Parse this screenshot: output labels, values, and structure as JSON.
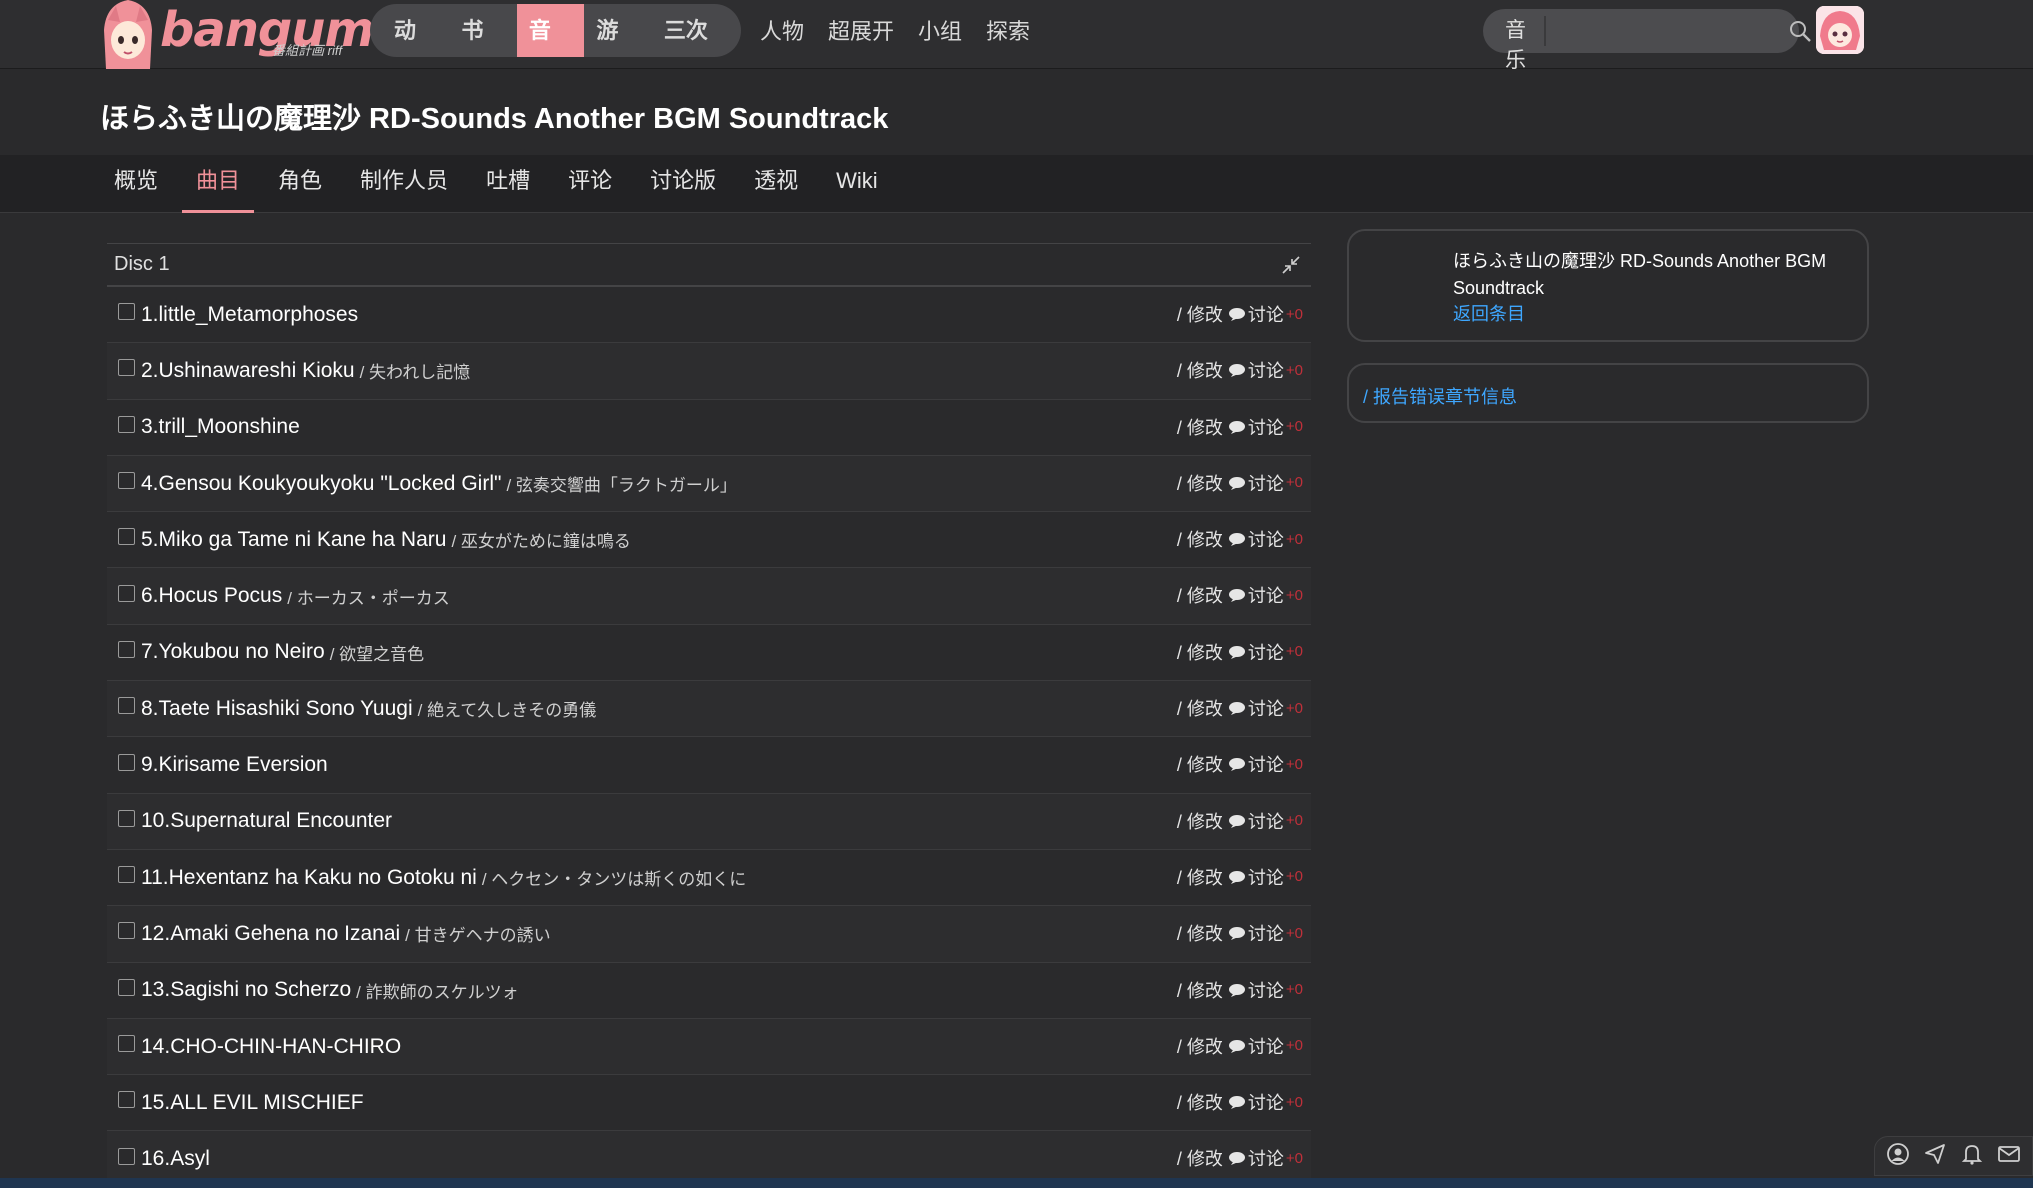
{
  "header": {
    "logo_text": "bangumi",
    "logo_sub": "番組計画 riff",
    "category_tabs": [
      {
        "label": "动画",
        "active": false
      },
      {
        "label": "书籍",
        "active": false
      },
      {
        "label": "音乐",
        "active": true
      },
      {
        "label": "游戏",
        "active": false
      },
      {
        "label": "三次元",
        "active": false
      }
    ],
    "nav_links": [
      "人物",
      "超展开",
      "小组",
      "探索"
    ],
    "search": {
      "category": "音乐",
      "value": ""
    }
  },
  "page": {
    "title": "ほらふき山の魔理沙 RD-Sounds Another BGM Soundtrack",
    "tabs": [
      {
        "label": "概览",
        "active": false
      },
      {
        "label": "曲目",
        "active": true
      },
      {
        "label": "角色",
        "active": false
      },
      {
        "label": "制作人员",
        "active": false
      },
      {
        "label": "吐槽",
        "active": false
      },
      {
        "label": "评论",
        "active": false
      },
      {
        "label": "讨论版",
        "active": false
      },
      {
        "label": "透视",
        "active": false
      },
      {
        "label": "Wiki",
        "active": false
      }
    ]
  },
  "tracklist": {
    "disc_title": "Disc 1",
    "edit_label": "/ 修改",
    "discuss_label": "讨论",
    "plus_label": "+0",
    "tracks": [
      {
        "name": "1.little_Metamorphoses",
        "sub": ""
      },
      {
        "name": "2.Ushinawareshi Kioku",
        "sub": "/ 失われし記憶"
      },
      {
        "name": "3.trill_Moonshine",
        "sub": ""
      },
      {
        "name": "4.Gensou Koukyoukyoku \"Locked Girl\"",
        "sub": "/ 弦奏交響曲「ラクトガール」"
      },
      {
        "name": "5.Miko ga Tame ni Kane ha Naru",
        "sub": "/ 巫女がために鐘は鳴る"
      },
      {
        "name": "6.Hocus Pocus",
        "sub": "/ ホーカス・ポーカス"
      },
      {
        "name": "7.Yokubou no Neiro",
        "sub": "/ 欲望之音色"
      },
      {
        "name": "8.Taete Hisashiki Sono Yuugi",
        "sub": "/ 絶えて久しきその勇儀"
      },
      {
        "name": "9.Kirisame Eversion",
        "sub": ""
      },
      {
        "name": "10.Supernatural Encounter",
        "sub": ""
      },
      {
        "name": "11.Hexentanz ha Kaku no Gotoku ni",
        "sub": "/ ヘクセン・タンツは斯くの如くに"
      },
      {
        "name": "12.Amaki Gehena no Izanai",
        "sub": "/ 甘きゲヘナの誘い"
      },
      {
        "name": "13.Sagishi no Scherzo",
        "sub": "/ 詐欺師のスケルツォ"
      },
      {
        "name": "14.CHO-CHIN-HAN-CHIRO",
        "sub": ""
      },
      {
        "name": "15.ALL EVIL MISCHIEF",
        "sub": ""
      },
      {
        "name": "16.Asyl",
        "sub": ""
      }
    ]
  },
  "sidebar": {
    "title": "ほらふき山の魔理沙 RD-Sounds Another BGM Soundtrack",
    "back_link": "返回条目",
    "report_link": "/ 报告错误章节信息"
  },
  "colors": {
    "accent": "#f09199",
    "link": "#3ea7ff",
    "plus": "#c0303a"
  }
}
